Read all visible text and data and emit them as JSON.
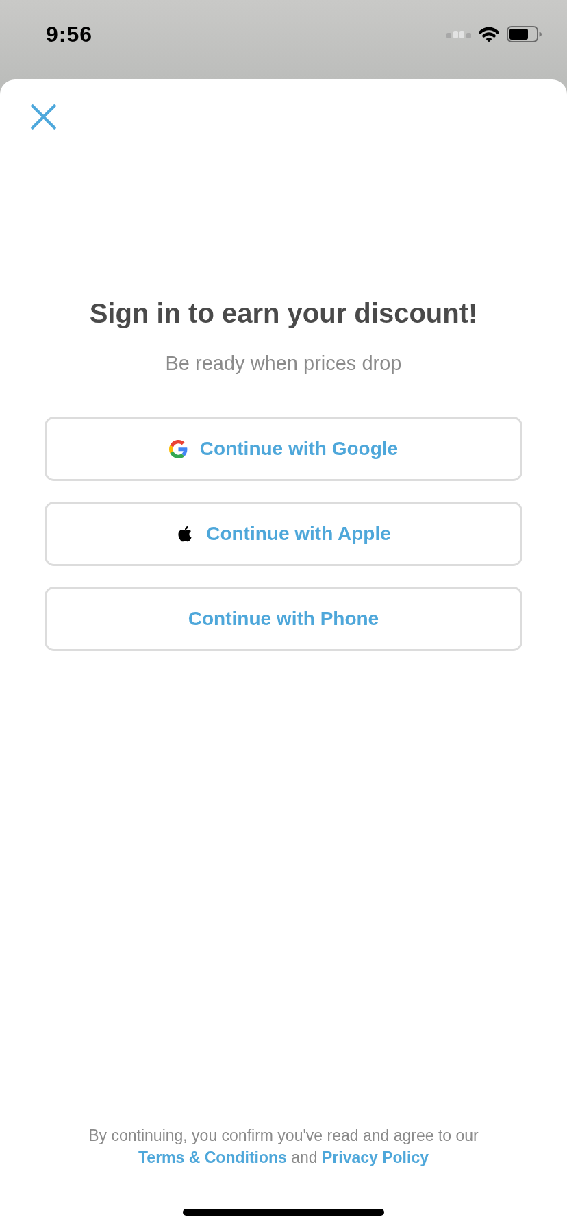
{
  "status_bar": {
    "time": "9:56"
  },
  "sheet": {
    "title": "Sign in to earn your discount!",
    "subtitle": "Be ready when prices drop",
    "buttons": [
      {
        "kind": "google",
        "label": "Continue with Google"
      },
      {
        "kind": "apple",
        "label": "Continue with Apple"
      },
      {
        "kind": "phone",
        "label": "Continue with Phone"
      }
    ],
    "legal": [
      {
        "kind": "text",
        "text": "By continuing, you confirm you've read and agree to our"
      },
      {
        "kind": "link",
        "text": "Terms & Conditions"
      },
      {
        "kind": "text",
        "text": "and"
      },
      {
        "kind": "link",
        "text": "Privacy Policy"
      }
    ]
  }
}
